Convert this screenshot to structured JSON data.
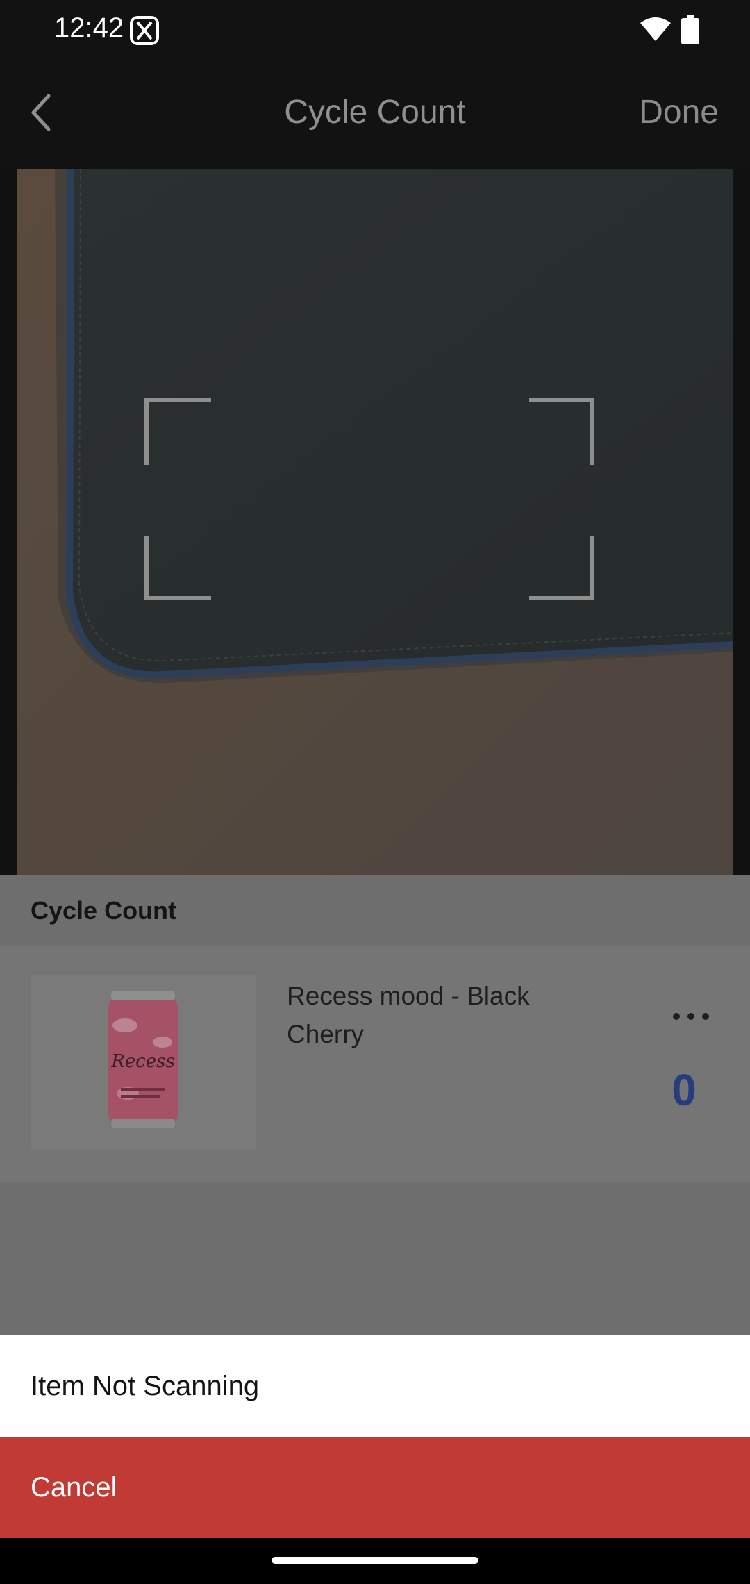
{
  "status_bar": {
    "time": "12:42",
    "icons": [
      "app-notification-icon",
      "wifi-icon",
      "battery-icon"
    ]
  },
  "header": {
    "title": "Cycle Count",
    "back_icon": "chevron-left-icon",
    "done_label": "Done"
  },
  "scanner": {
    "frame_icon": "scan-frame-corners"
  },
  "cycle_count": {
    "section_title": "Cycle Count",
    "items": [
      {
        "name": "Recess mood - Black Cherry",
        "image": "soda-can-image",
        "product_brand": "Recess",
        "more_icon": "more-horizontal-icon",
        "count": "0"
      }
    ]
  },
  "action_sheet": {
    "option_label": "Item Not Scanning",
    "cancel_label": "Cancel"
  },
  "colors": {
    "cancel_background": "#c13a34",
    "count_text": "#253e7b",
    "overlay": "#6e6e6e"
  }
}
